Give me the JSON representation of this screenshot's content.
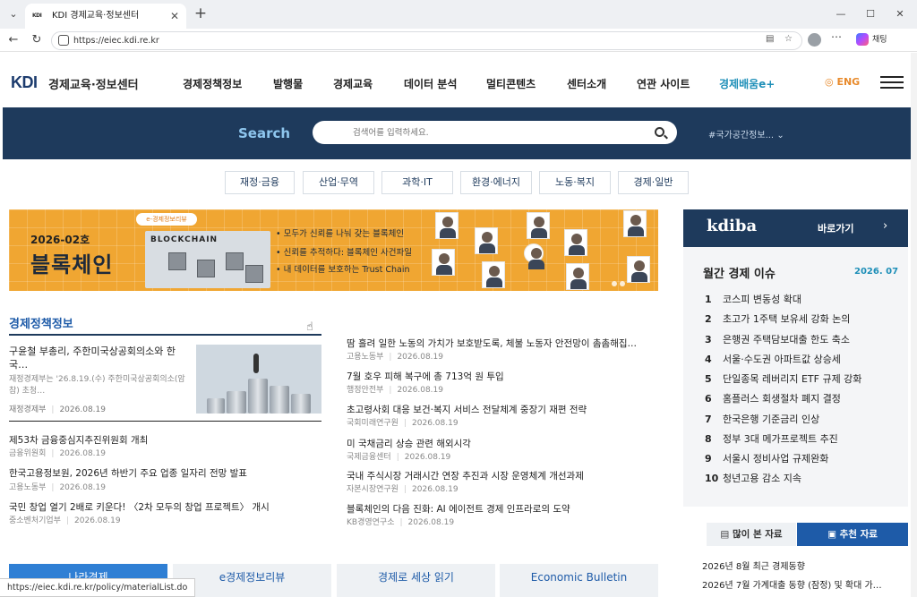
{
  "browser": {
    "tab_title": "KDI 경제교육·정보센터",
    "tab_favicon": "KDI",
    "url": "https://eiec.kdi.re.kr",
    "chat_label": "채팅",
    "status_url": "https://eiec.kdi.re.kr/policy/materialList.do"
  },
  "header": {
    "logo": "KDI",
    "logo_sub": "경제교육·정보센터",
    "nav": [
      "경제정책정보",
      "발행물",
      "경제교육",
      "데이터 분석",
      "멀티콘텐츠",
      "센터소개",
      "연관 사이트",
      "경제배움e+"
    ],
    "lang": "ENG"
  },
  "search": {
    "label": "Search",
    "placeholder": "검색어를 입력하세요.",
    "hashtag": "#국가공간정보..."
  },
  "categories": [
    "재정·금융",
    "산업·무역",
    "과학·IT",
    "환경·에너지",
    "노동·복지",
    "경제·일반"
  ],
  "banner": {
    "issue": "2026-02호",
    "title": "블록체인",
    "brand": "e-경제정보리뷰",
    "block_label": "BLOCKCHAIN",
    "bullets": [
      "모두가 신뢰를 나눠 갖는 블록체인",
      "신뢰를 추적하다: 블록체인 사건파일",
      "내 데이터를 보호하는 Trust Chain"
    ]
  },
  "kdiba": {
    "logo": "kdiba",
    "go": "바로가기"
  },
  "monthly": {
    "title": "월간 경제 이슈",
    "date": "2026. 07",
    "items": [
      "코스피 변동성 확대",
      "초고가 1주택 보유세 강화 논의",
      "은행권 주택담보대출 한도 축소",
      "서울·수도권 아파트값 상승세",
      "단일종목 레버리지 ETF 규제 강화",
      "홈플러스 회생절차 폐지 결정",
      "한국은행 기준금리 인상",
      "정부 3대 메가프로젝트 추진",
      "서울시 정비사업 규제완화",
      "청년고용 감소 지속"
    ]
  },
  "reco": {
    "tab_popular": "많이 본 자료",
    "tab_reco": "추천 자료",
    "items": [
      "2026년 8월 최근 경제동향",
      "2026년 7월 가계대출 동향 (잠정) 및 확대 가…"
    ]
  },
  "policy": {
    "title": "경제정책정보",
    "featured": {
      "title": "구윤철 부총리, 주한미국상공회의소와 한국…",
      "desc": "재정경제부는 '26.8.19.(수) 주한미국상공회의소(암참) 초청…",
      "org": "재정경제부",
      "date": "2026.08.19"
    },
    "left": [
      {
        "title": "제53차 금융중심지추진위원회 개최",
        "org": "금융위원회",
        "date": "2026.08.19"
      },
      {
        "title": "한국고용정보원, 2026년 하반기 주요 업종 일자리 전망 발표",
        "org": "고용노동부",
        "date": "2026.08.19"
      },
      {
        "title": "국민 창업 열기 2배로 키운다! 〈2차 모두의 창업 프로젝트〉 개시",
        "org": "중소벤처기업부",
        "date": "2026.08.19"
      }
    ],
    "right": [
      {
        "title": "땀 흘려 일한 노동의 가치가 보호받도록, 체불 노동자 안전망이 촘촘해집…",
        "org": "고용노동부",
        "date": "2026.08.19"
      },
      {
        "title": "7월 호우 피해 복구에 총 713억 원 투입",
        "org": "행정안전부",
        "date": "2026.08.19"
      },
      {
        "title": "초고령사회 대응 보건·복지 서비스 전달체계 중장기 재편 전략",
        "org": "국회미래연구원",
        "date": "2026.08.19"
      },
      {
        "title": "미 국채금리 상승 관련 해외시각",
        "org": "국제금융센터",
        "date": "2026.08.19"
      },
      {
        "title": "국내 주식시장 거래시간 연장 추진과 시장 운영체계 개선과제",
        "org": "자본시장연구원",
        "date": "2026.08.19"
      },
      {
        "title": "블록체인의 다음 진화: AI 에이전트 경제 인프라로의 도약",
        "org": "KB경영연구소",
        "date": "2026.08.19"
      }
    ]
  },
  "bottom_tabs": [
    "나라경제",
    "e경제정보리뷰",
    "경제로 세상 읽기",
    "Economic Bulletin"
  ],
  "colors": {
    "navy": "#1e3a5c",
    "accent": "#1e5ba8",
    "orange": "#f0a632"
  }
}
